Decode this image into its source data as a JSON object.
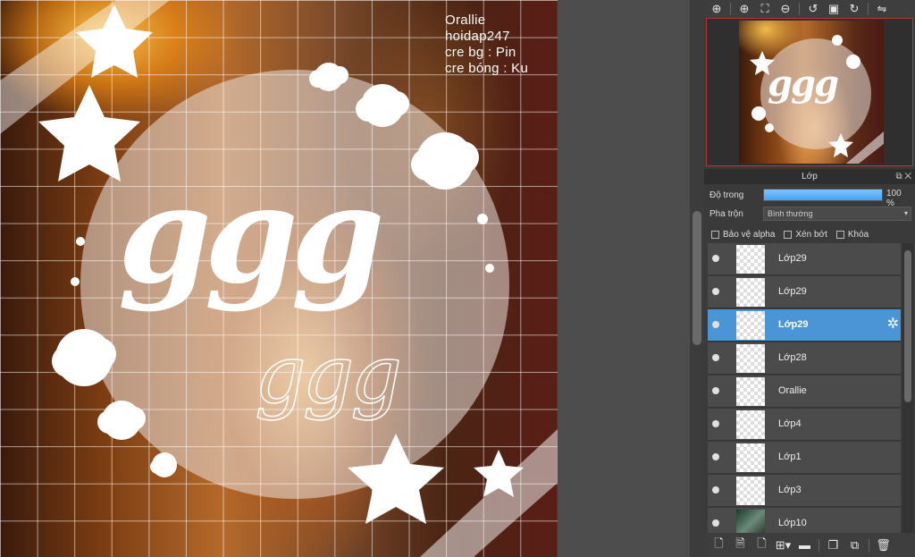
{
  "canvas": {
    "credits": [
      "Orallie",
      "hoidap247",
      "cre bg : Pin",
      "cre bóng : Ku"
    ],
    "big_text": "ggg",
    "outline_text": "ggg"
  },
  "nav_toolbar": {
    "icons": [
      "zoom-navigator-icon",
      "zoom-in-icon",
      "fit-window-icon",
      "zoom-out-icon",
      "rotate-left-icon",
      "actual-size-icon",
      "rotate-right-icon",
      "flip-icon"
    ],
    "glyphs": [
      "⊕",
      "⊕",
      "⛶",
      "⊖",
      "↺",
      "▣",
      "↻",
      "⇋"
    ]
  },
  "layer_panel": {
    "title": "Lớp",
    "opacity_label": "Độ trong",
    "opacity_value": "100 %",
    "opacity_fraction": 1.0,
    "blend_label": "Pha trộn",
    "blend_value": "Bình thường",
    "checks": [
      "Bảo vệ alpha",
      "Xén bớt",
      "Khóa"
    ],
    "layers": [
      {
        "name": "Lớp29",
        "selected": false,
        "thumb": "transparent"
      },
      {
        "name": "Lớp29",
        "selected": false,
        "thumb": "transparent"
      },
      {
        "name": "Lớp29",
        "selected": true,
        "thumb": "transparent"
      },
      {
        "name": "Lớp28",
        "selected": false,
        "thumb": "transparent"
      },
      {
        "name": "Orallie",
        "selected": false,
        "thumb": "transparent"
      },
      {
        "name": "Lớp4",
        "selected": false,
        "thumb": "transparent"
      },
      {
        "name": "Lớp1",
        "selected": false,
        "thumb": "transparent"
      },
      {
        "name": "Lớp3",
        "selected": false,
        "thumb": "transparent"
      },
      {
        "name": "Lớp10",
        "selected": false,
        "thumb": "photo"
      }
    ]
  },
  "layer_toolbar": {
    "icons": [
      "new-layer-icon",
      "new-layer-8bit-icon",
      "new-layer-1bit-icon",
      "add-layer-menu-icon",
      "new-folder-icon",
      "duplicate-layer-icon",
      "merge-layer-icon",
      "delete-layer-icon"
    ],
    "glyphs": [
      "🗋",
      "🗎",
      "🗋",
      "⊞▾",
      "▬",
      "❐",
      "⧉",
      "🗑"
    ]
  }
}
